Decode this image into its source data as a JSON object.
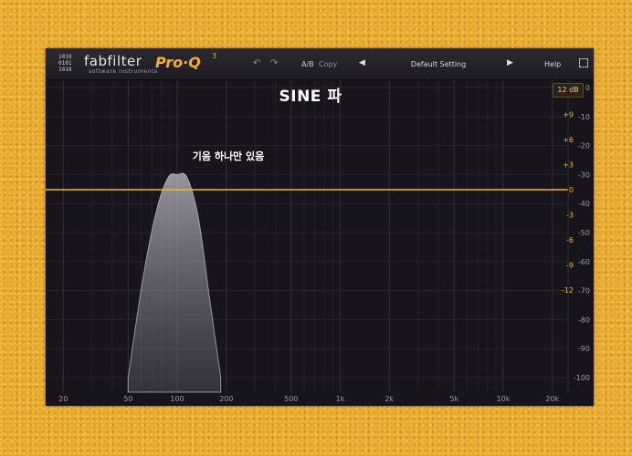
{
  "header": {
    "brand": "fabfilter",
    "brand_sub": "software instruments",
    "product": "Pro·Q",
    "product_version": "3",
    "undo_icon": "↶",
    "redo_icon": "↷",
    "ab_label": "A/B",
    "copy_label": "Copy",
    "prev_icon": "◀",
    "preset_name": "Default Setting",
    "next_icon": "▶",
    "help_label": "Help"
  },
  "range_button": "12 dB",
  "overlay": {
    "title": "SINE 파",
    "note": "기음 하나만 있음"
  },
  "colors": {
    "accent": "#f3b02c",
    "eq_line": "#f2b52d",
    "background": "#17151b"
  },
  "chart_data": {
    "type": "area",
    "x_scale": "log",
    "x_ticks": [
      "20",
      "50",
      "100",
      "200",
      "500",
      "1k",
      "2k",
      "5k",
      "10k",
      "20k"
    ],
    "x_tick_values": [
      20,
      50,
      100,
      200,
      500,
      1000,
      2000,
      5000,
      10000,
      20000
    ],
    "eq_gain_ticks": [
      "+9",
      "+6",
      "+3",
      "0",
      "-3",
      "-6",
      "-9",
      "-12"
    ],
    "eq_gain_values": [
      9,
      6,
      3,
      0,
      -3,
      -6,
      -9,
      -12
    ],
    "spectrum_ticks": [
      "0",
      "-10",
      "-20",
      "-30",
      "-40",
      "-50",
      "-60",
      "-70",
      "-80",
      "-90",
      "-100"
    ],
    "spectrum_values": [
      0,
      -10,
      -20,
      -30,
      -40,
      -50,
      -60,
      -70,
      -80,
      -90,
      -100
    ],
    "eq_curve_gain_db": 0,
    "spectrum_peak": {
      "frequency_hz": 100,
      "level_db": -30
    },
    "spectrum_floor_db": -100,
    "spectrum_skirt": [
      {
        "frequency_hz": 50,
        "level_db": -100
      },
      {
        "frequency_hz": 62,
        "level_db": -65
      },
      {
        "frequency_hz": 75,
        "level_db": -42
      },
      {
        "frequency_hz": 88,
        "level_db": -31
      },
      {
        "frequency_hz": 100,
        "level_db": -30
      },
      {
        "frequency_hz": 115,
        "level_db": -31
      },
      {
        "frequency_hz": 135,
        "level_db": -45
      },
      {
        "frequency_hz": 160,
        "level_db": -75
      },
      {
        "frequency_hz": 185,
        "level_db": -100
      }
    ]
  }
}
